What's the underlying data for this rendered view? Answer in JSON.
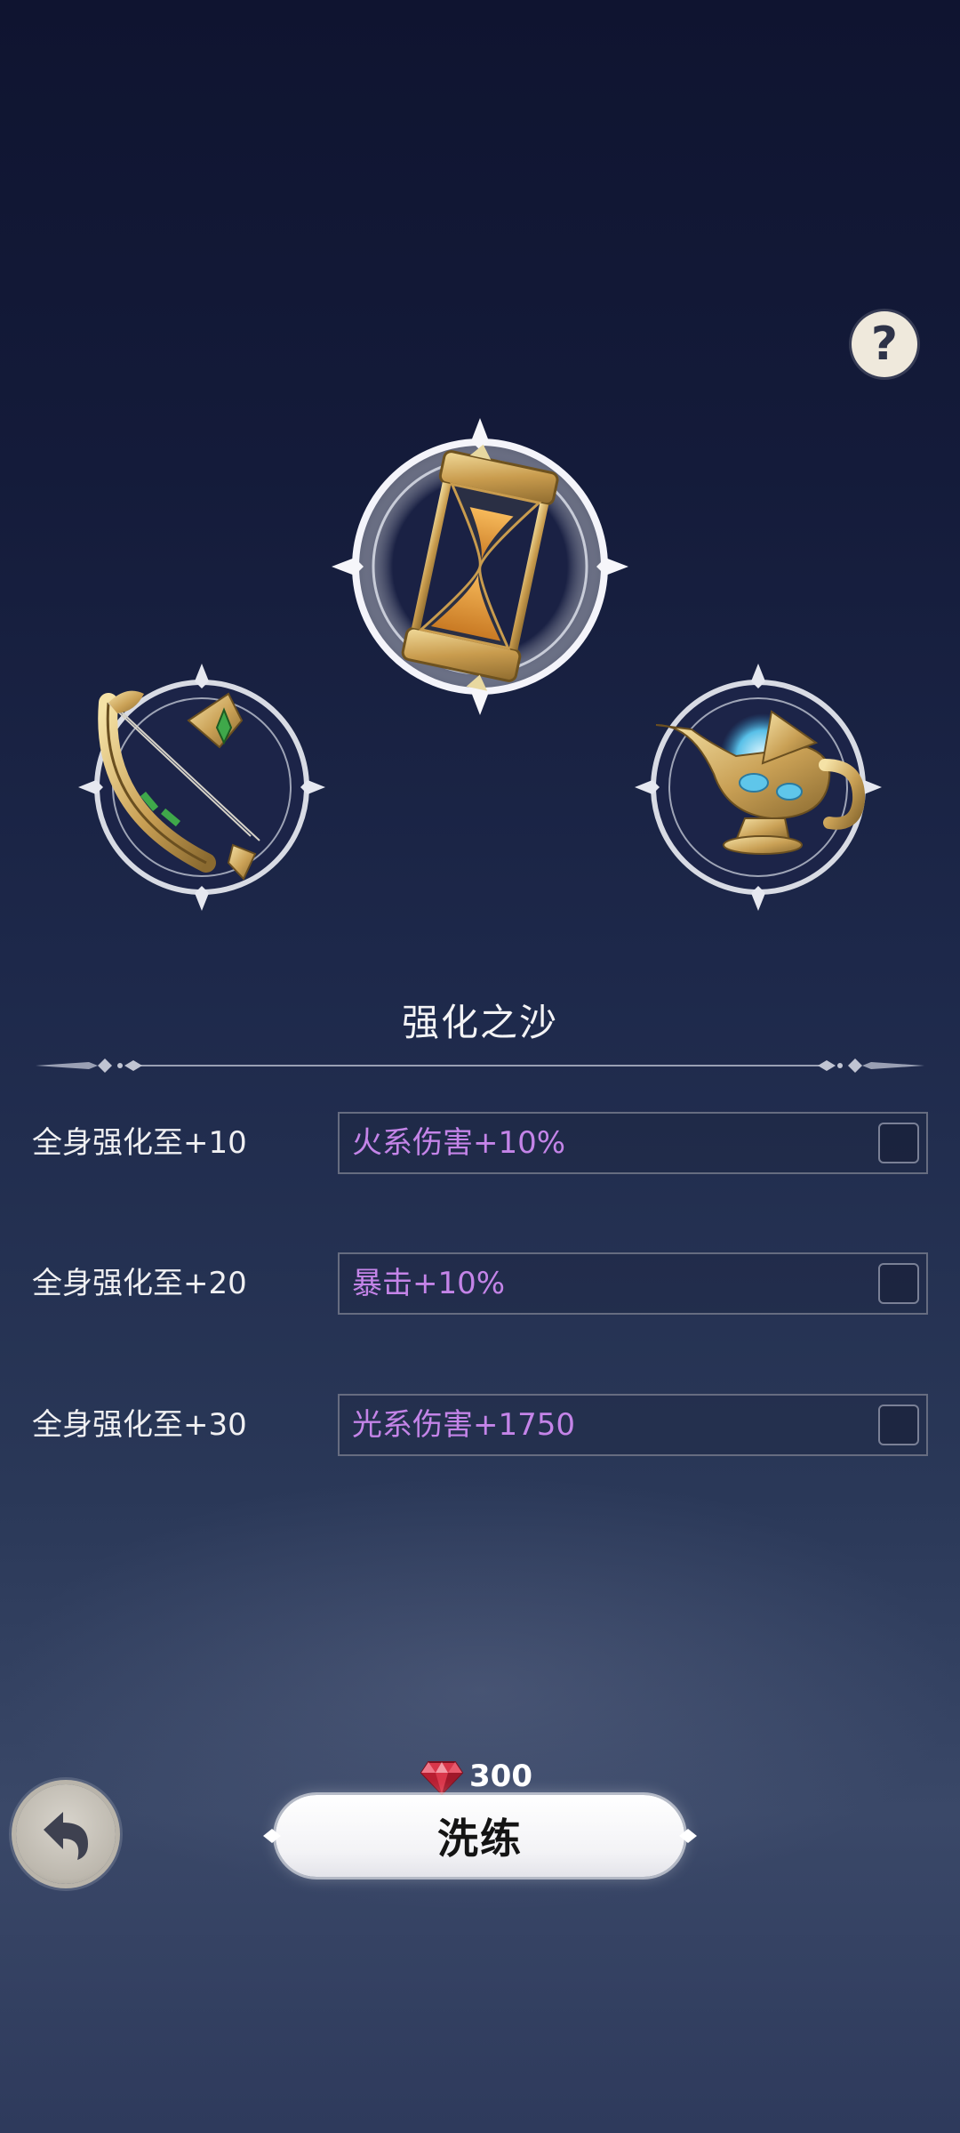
{
  "help": {
    "label": "?"
  },
  "relics": {
    "center": "hourglass-icon",
    "left": "bow-icon",
    "right": "magic-lamp-icon"
  },
  "section": {
    "title": "强化之沙"
  },
  "rows": [
    {
      "label": "全身强化至+10",
      "value": "火系伤害+10%"
    },
    {
      "label": "全身强化至+20",
      "value": "暴击+10%"
    },
    {
      "label": "全身强化至+30",
      "value": "光系伤害+1750"
    }
  ],
  "cost": {
    "value": "300",
    "icon": "ruby-gem-icon"
  },
  "action": {
    "label": "洗练"
  },
  "colors": {
    "value_text": "#c484e8",
    "gold": "#d9b060",
    "background_top": "#0f1430",
    "background_bottom": "#3a4868"
  }
}
